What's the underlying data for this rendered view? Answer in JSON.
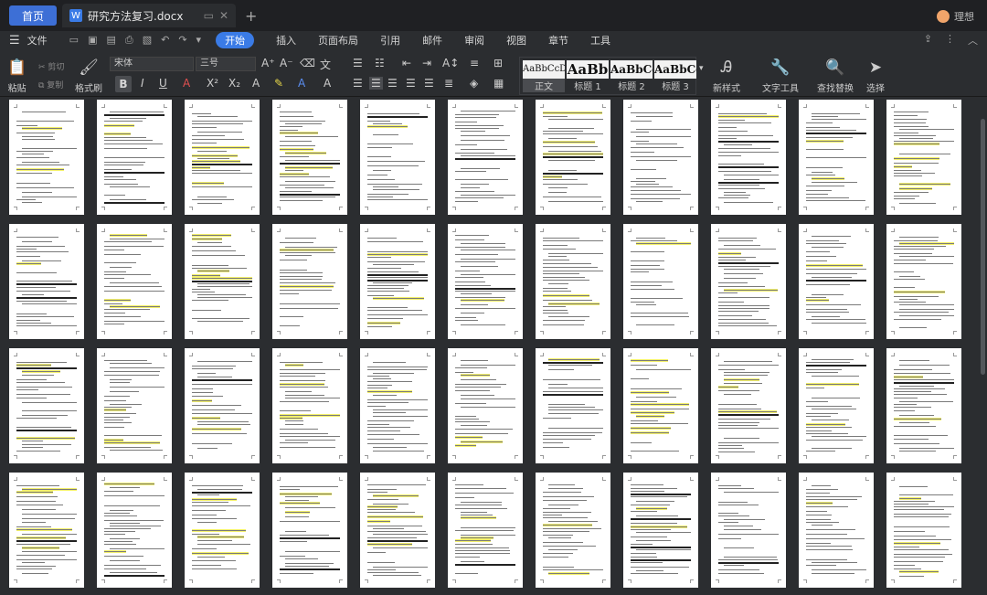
{
  "titlebar": {
    "home_tab": "首页",
    "doc_tab": "研究方法复习.docx",
    "doc_icon": "W",
    "user_name": "理想"
  },
  "menu": {
    "file": "文件",
    "tabs": [
      "开始",
      "插入",
      "页面布局",
      "引用",
      "邮件",
      "审阅",
      "视图",
      "章节",
      "工具"
    ],
    "active": "开始"
  },
  "ribbon": {
    "paste": "粘贴",
    "cut": "剪切",
    "copy": "复制",
    "format_painter": "格式刷",
    "font_name": "宋体",
    "font_size": "三号",
    "styles": [
      {
        "preview": "AaBbCcDd",
        "label": "正文"
      },
      {
        "preview": "AaBb",
        "label": "标题 1"
      },
      {
        "preview": "AaBbCc",
        "label": "标题 2"
      },
      {
        "preview": "AaBbCc",
        "label": "标题 3"
      }
    ],
    "new_style": "新样式",
    "text_tools": "文字工具",
    "find_replace": "查找替换",
    "select": "选择"
  },
  "accent_color": "#3a7be6",
  "highlight_color": "#f3f06a"
}
